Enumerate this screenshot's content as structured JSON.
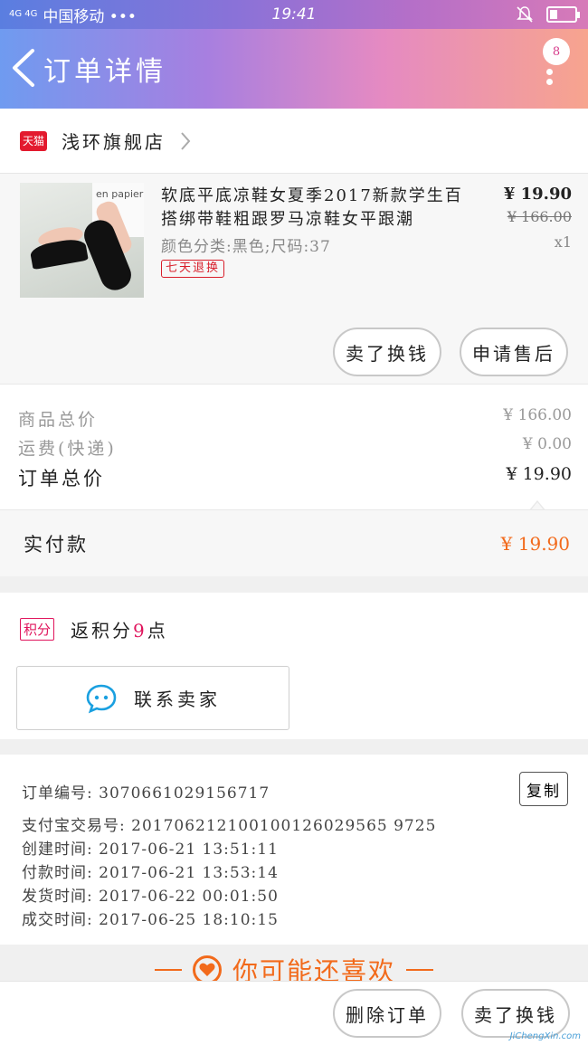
{
  "status_bar": {
    "network": "4G 4G",
    "carrier": "中国移动 •••",
    "time": "19:41"
  },
  "header": {
    "title": "订单详情",
    "badge_count": "8"
  },
  "shop": {
    "platform_badge": "天猫",
    "name": "浅环旗舰店"
  },
  "product": {
    "title": "软底平底凉鞋女夏季2017新款学生百搭绑带鞋粗跟罗马凉鞋女平跟潮",
    "spec": "颜色分类:黑色;尺码:37",
    "tag": "七天退换",
    "price": "¥ 19.90",
    "original_price": "¥ 166.00",
    "quantity": "x1",
    "image_caption": "en papier",
    "actions": {
      "sell_label": "卖了换钱",
      "after_sale_label": "申请售后"
    }
  },
  "summary": {
    "goods_total_label": "商品总价",
    "goods_total_value": "¥ 166.00",
    "shipping_label": "运费(快递)",
    "shipping_value": "¥ 0.00",
    "order_total_label": "订单总价",
    "order_total_value": "¥ 19.90",
    "paid_label": "实付款",
    "paid_value": "¥ 19.90"
  },
  "points": {
    "badge": "积分",
    "text_prefix": "返积分",
    "value": "9",
    "text_suffix": "点"
  },
  "contact": {
    "label": "联系卖家"
  },
  "order_info": {
    "order_no": "订单编号: 3070661029156717",
    "copy_label": "复制",
    "alipay_no": "支付宝交易号: 201706212100100126029565 9725",
    "created": "创建时间: 2017-06-21 13:51:11",
    "paid": "付款时间: 2017-06-21 13:53:14",
    "shipped": "发货时间: 2017-06-22 00:01:50",
    "completed": "成交时间: 2017-06-25 18:10:15"
  },
  "recommend": {
    "title": "你可能还喜欢"
  },
  "bottom_bar": {
    "delete_label": "删除订单",
    "sell_label": "卖了换钱"
  },
  "watermark": "JiChengXin.com",
  "colors": {
    "accent_orange": "#f26a1b",
    "tmall_red": "#e31a2e",
    "points_pink": "#e0145c"
  }
}
